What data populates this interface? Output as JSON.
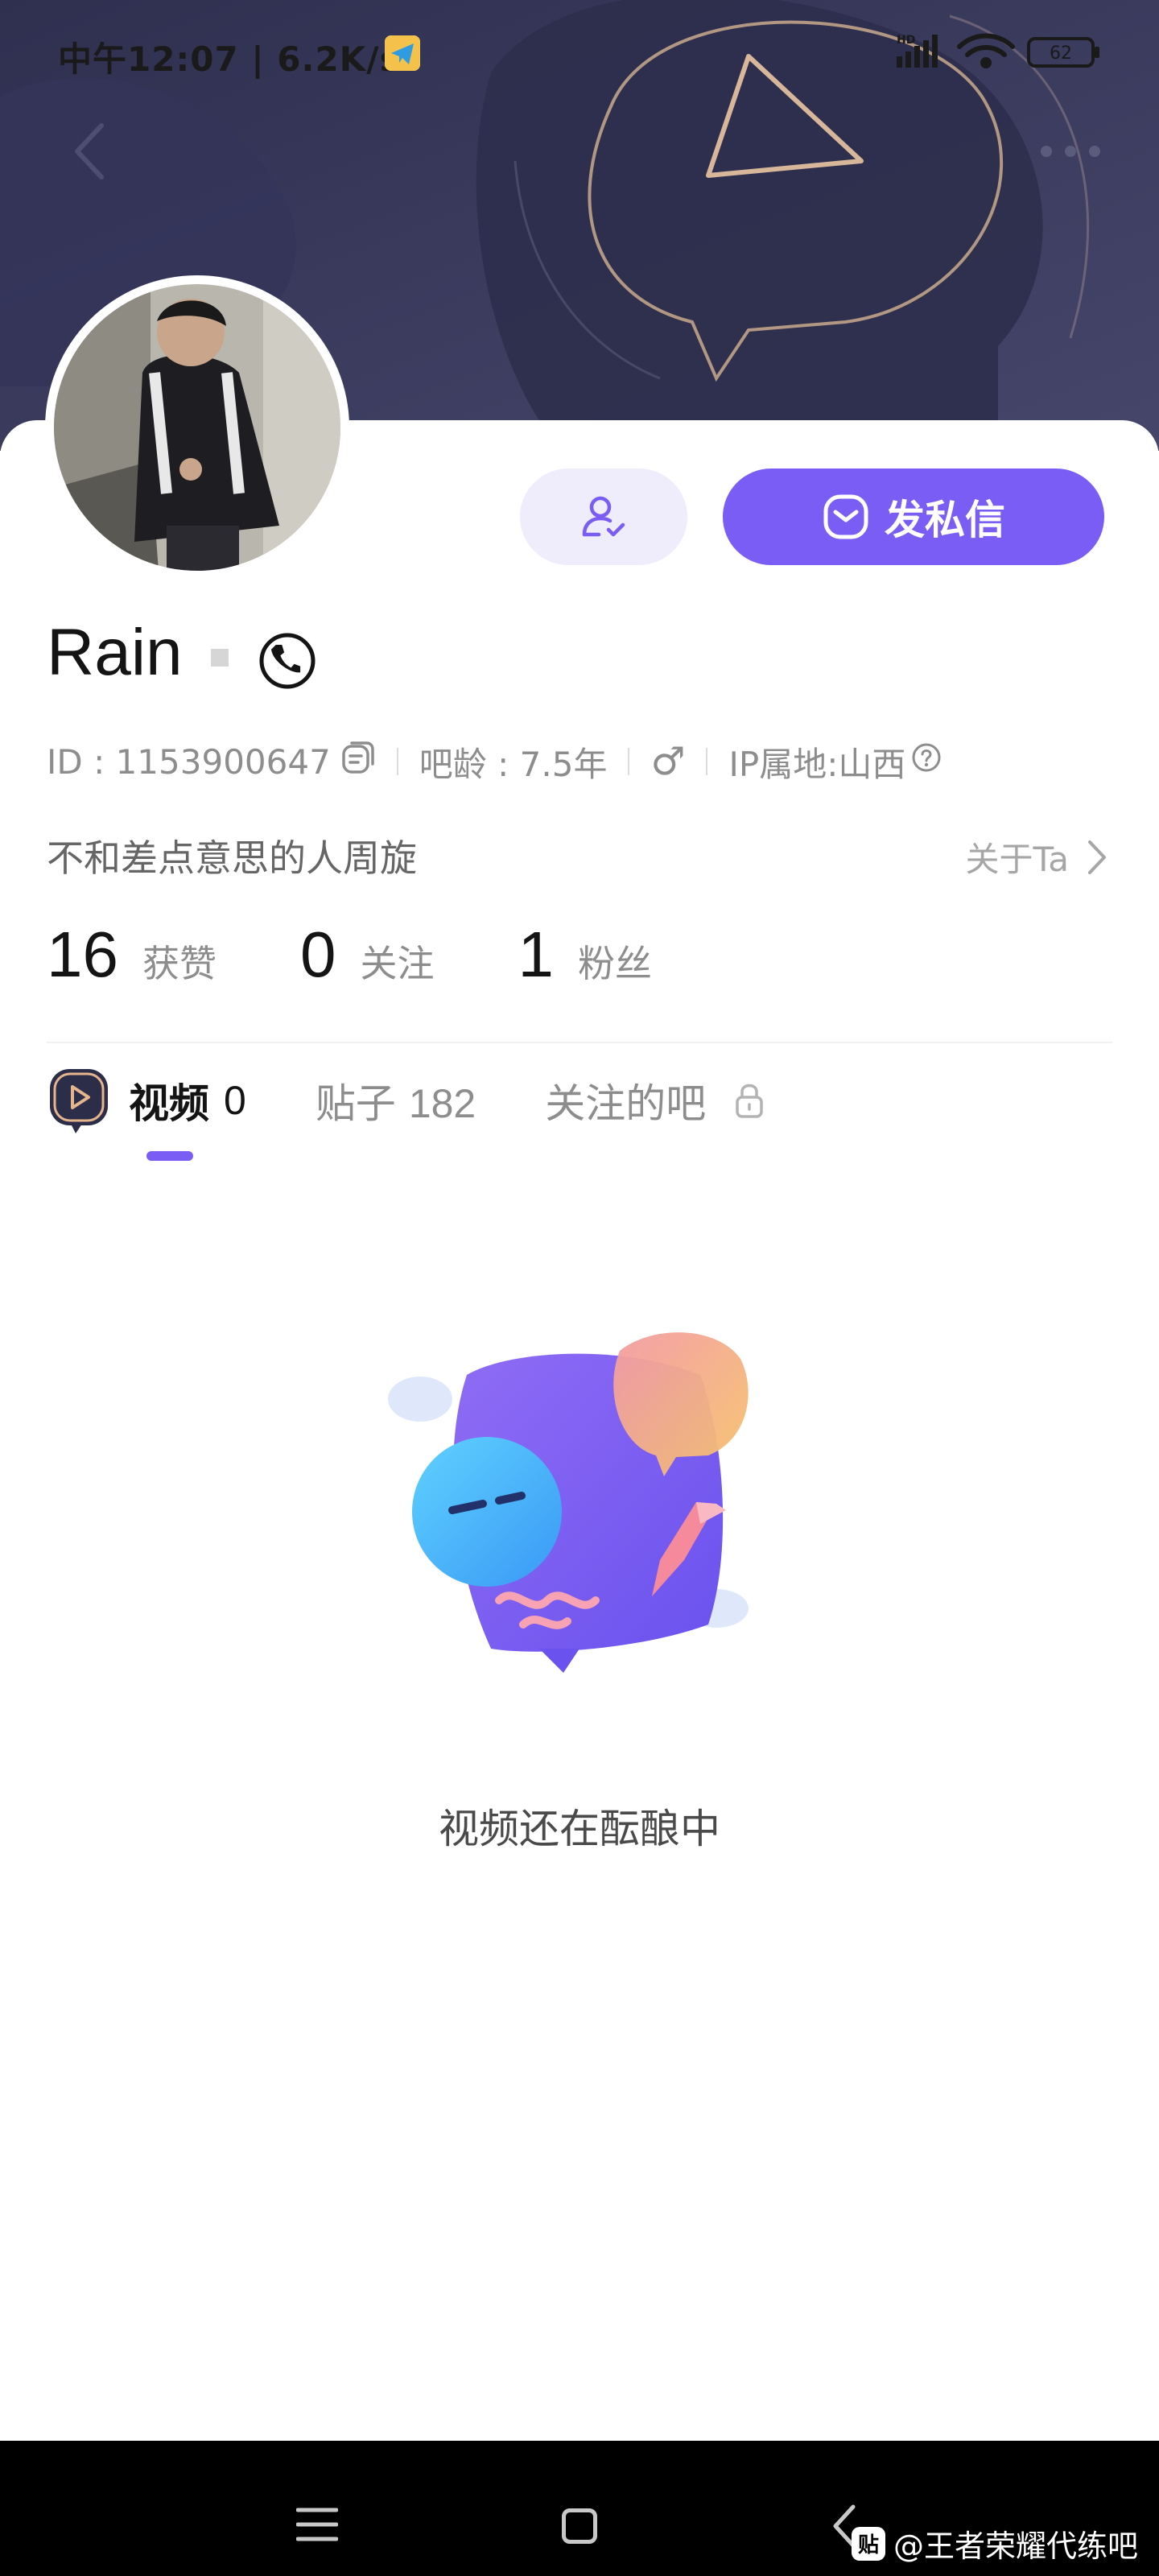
{
  "status_bar": {
    "time_speed": "中午12:07 | 6.2K/s",
    "network_badge": "HD",
    "battery": "62"
  },
  "profile": {
    "username": "Rain",
    "id_label": "ID : 1153900647",
    "forum_age": "吧龄 : 7.5年",
    "gender_symbol": "♂",
    "ip_location": "IP属地:山西",
    "bio": "不和差点意思的人周旋",
    "about_link": "关于Ta",
    "message_button": "发私信"
  },
  "stats": [
    {
      "value": "16",
      "label": "获赞"
    },
    {
      "value": "0",
      "label": "关注"
    },
    {
      "value": "1",
      "label": "粉丝"
    }
  ],
  "tabs": {
    "videos_label": "视频",
    "videos_count": "0",
    "posts_label": "贴子",
    "posts_count": "182",
    "forums_label": "关注的吧"
  },
  "empty_state": {
    "message": "视频还在酝酿中"
  },
  "watermark": {
    "logo": "贴",
    "text": "@王者荣耀代练吧"
  },
  "colors": {
    "accent": "#7a5df5",
    "banner": "#3a3b5c",
    "follow_bg": "#efedfc"
  }
}
